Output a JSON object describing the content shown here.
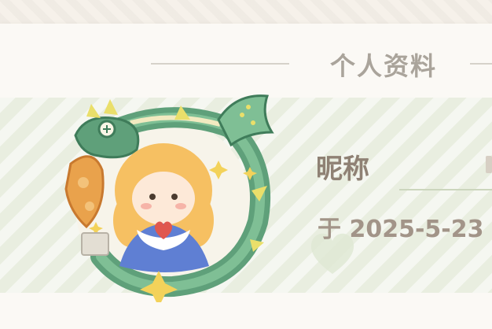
{
  "panel": {
    "title": "个人资料"
  },
  "profile": {
    "nickname_label": "昵称",
    "joined_date": "于 2025-5-23"
  },
  "colors": {
    "band_green": "#e9eee0",
    "title_gray": "#aaa49b",
    "label_brown": "#8f8174",
    "dragon_green": "#5fa07a",
    "hair_orange": "#f6c062",
    "dress_blue": "#5f7fd3"
  },
  "icons": {
    "avatar": "dragon-and-girl-avatar-icon",
    "watermark": "heart-watermark-icon"
  }
}
